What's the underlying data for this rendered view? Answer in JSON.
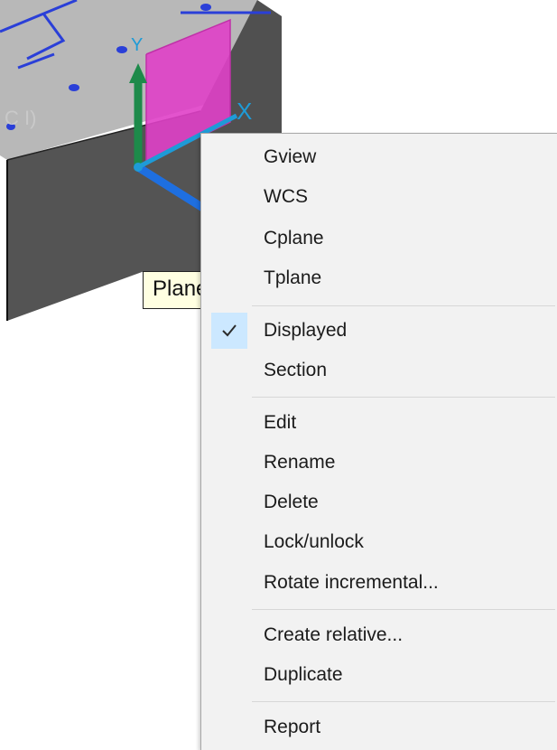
{
  "tooltip": {
    "text": "Plane"
  },
  "context_menu": {
    "items": [
      {
        "label": "Gview"
      },
      {
        "label": "WCS"
      },
      {
        "label": "Cplane"
      },
      {
        "label": "Tplane"
      },
      {
        "label": "Displayed",
        "checked": true
      },
      {
        "label": "Section"
      },
      {
        "label": "Edit"
      },
      {
        "label": "Rename"
      },
      {
        "label": "Delete"
      },
      {
        "label": "Lock/unlock"
      },
      {
        "label": "Rotate incremental..."
      },
      {
        "label": "Create relative..."
      },
      {
        "label": "Duplicate"
      },
      {
        "label": "Report"
      }
    ]
  },
  "colors": {
    "menu_background": "#f2f2f2",
    "check_highlight": "#cce8ff",
    "tooltip_background": "#ffffe1",
    "plane_magenta": "#e040c8",
    "axis_blue": "#1e6fe0",
    "axis_green": "#1d8a4a"
  },
  "icons": {
    "check": "checkmark-icon"
  }
}
